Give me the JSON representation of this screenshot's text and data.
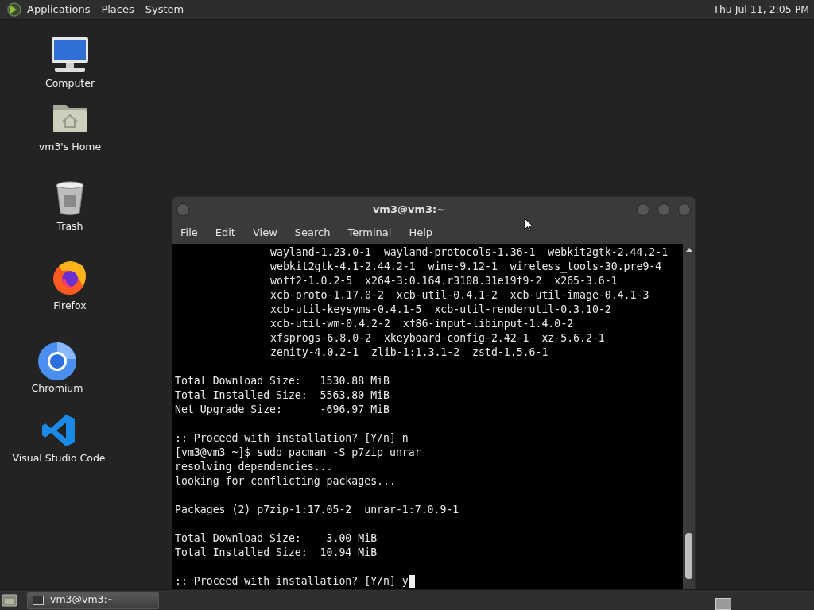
{
  "top_panel": {
    "menus": [
      "Applications",
      "Places",
      "System"
    ],
    "clock": "Thu Jul 11,  2:05 PM"
  },
  "desktop_icons": [
    {
      "kind": "computer",
      "label": "Computer"
    },
    {
      "kind": "home",
      "label": "vm3's Home"
    },
    {
      "kind": "trash",
      "label": "Trash"
    },
    {
      "kind": "firefox",
      "label": "Firefox"
    },
    {
      "kind": "chromium",
      "label": "Chromium"
    },
    {
      "kind": "vscode",
      "label": "Visual Studio Code"
    }
  ],
  "window": {
    "title": "vm3@vm3:~",
    "menu": [
      "File",
      "Edit",
      "View",
      "Search",
      "Terminal",
      "Help"
    ],
    "terminal": {
      "blocks": [
        [
          {
            "kind": "indented",
            "text": "wayland-1.23.0-1  wayland-protocols-1.36-1  webkit2gtk-2.44.2-1"
          },
          {
            "kind": "indented",
            "text": "webkit2gtk-4.1-2.44.2-1  wine-9.12-1  wireless_tools-30.pre9-4"
          },
          {
            "kind": "indented",
            "text": "woff2-1.0.2-5  x264-3:0.164.r3108.31e19f9-2  x265-3.6-1"
          },
          {
            "kind": "indented",
            "text": "xcb-proto-1.17.0-2  xcb-util-0.4.1-2  xcb-util-image-0.4.1-3"
          },
          {
            "kind": "indented",
            "text": "xcb-util-keysyms-0.4.1-5  xcb-util-renderutil-0.3.10-2"
          },
          {
            "kind": "indented",
            "text": "xcb-util-wm-0.4.2-2  xf86-input-libinput-1.4.0-2"
          },
          {
            "kind": "indented",
            "text": "xfsprogs-6.8.0-2  xkeyboard-config-2.42-1  xz-5.6.2-1"
          },
          {
            "kind": "indented",
            "text": "zenity-4.0.2-1  zlib-1:1.3.1-2  zstd-1.5.6-1"
          }
        ],
        [
          {
            "kind": "plain",
            "text": "Total Download Size:   1530.88 MiB"
          },
          {
            "kind": "plain",
            "text": "Total Installed Size:  5563.80 MiB"
          },
          {
            "kind": "plain",
            "text": "Net Upgrade Size:      -696.97 MiB"
          }
        ],
        [
          {
            "kind": "plain",
            "text": ":: Proceed with installation? [Y/n] n"
          },
          {
            "kind": "plain",
            "text": "[vm3@vm3 ~]$ sudo pacman -S p7zip unrar"
          },
          {
            "kind": "plain",
            "text": "resolving dependencies..."
          },
          {
            "kind": "plain",
            "text": "looking for conflicting packages..."
          }
        ],
        [
          {
            "kind": "plain",
            "text": "Packages (2) p7zip-1:17.05-2  unrar-1:7.0.9-1"
          }
        ],
        [
          {
            "kind": "plain",
            "text": "Total Download Size:    3.00 MiB"
          },
          {
            "kind": "plain",
            "text": "Total Installed Size:  10.94 MiB"
          }
        ],
        [
          {
            "kind": "plain",
            "text": ":: Proceed with installation? [Y/n] y"
          }
        ]
      ],
      "cursor": true
    }
  },
  "taskbar": {
    "tasks": [
      {
        "label": "vm3@vm3:~",
        "selected": false
      }
    ]
  }
}
